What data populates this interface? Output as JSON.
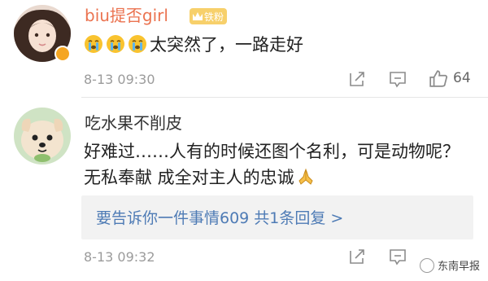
{
  "comments": [
    {
      "username": "biu提否girl",
      "badge": "铁粉",
      "text": "太突然了，一路走好",
      "emojis": [
        "crying-face-icon",
        "crying-face-icon",
        "crying-face-icon"
      ],
      "timestamp": "8-13 09:30",
      "like_count": "64"
    },
    {
      "username": "吃水果不削皮",
      "text_line1": "好难过……人有的时候还图个名利，可是动物呢？",
      "text_line2": "无私奉献 成全对主人的忠诚",
      "reply_summary": "要告诉你一件事情609 共1条回复 >",
      "timestamp": "8-13 09:32"
    }
  ],
  "watermark": "东南早报",
  "colors": {
    "vip_name": "#eb7350",
    "link": "#4e7bb5",
    "badge": "#f7d06b",
    "muted": "#9b9b9b"
  }
}
